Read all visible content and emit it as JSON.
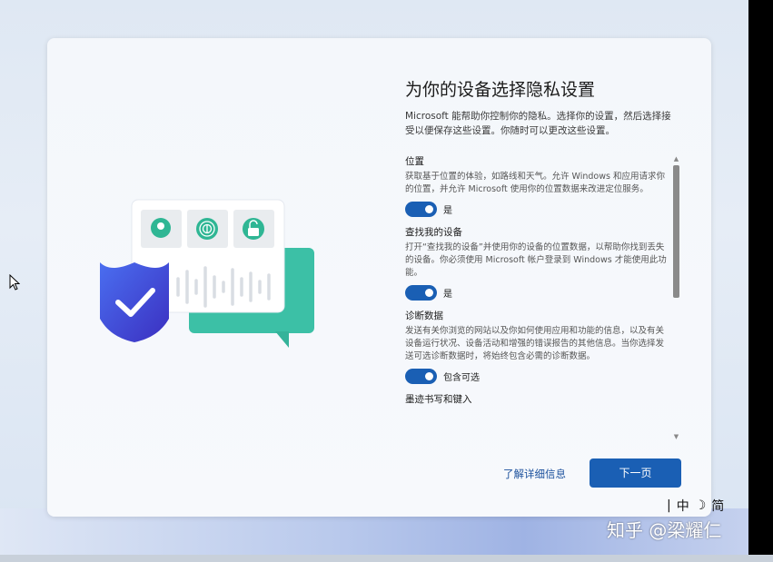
{
  "page": {
    "title": "为你的设备选择隐私设置",
    "description": "Microsoft 能帮助你控制你的隐私。选择你的设置，然后选择接受以便保存这些设置。你随时可以更改这些设置。"
  },
  "settings": [
    {
      "title": "位置",
      "description": "获取基于位置的体验，如路线和天气。允许 Windows 和应用请求你的位置，并允许 Microsoft 使用你的位置数据来改进定位服务。",
      "toggle_label": "是",
      "enabled": true
    },
    {
      "title": "查找我的设备",
      "description": "打开“查找我的设备”并使用你的设备的位置数据，以帮助你找到丢失的设备。你必须使用 Microsoft 帐户登录到 Windows 才能使用此功能。",
      "toggle_label": "是",
      "enabled": true
    },
    {
      "title": "诊断数据",
      "description": "发送有关你浏览的网站以及你如何使用应用和功能的信息，以及有关设备运行状况、设备活动和增强的错误报告的其他信息。当你选择发送可选诊断数据时，将始终包含必需的诊断数据。",
      "toggle_label": "包含可选",
      "enabled": true
    },
    {
      "title": "墨迹书写和键入"
    }
  ],
  "actions": {
    "learn_more": "了解详细信息",
    "next": "下一页"
  },
  "ime": {
    "separator": "|",
    "mode": "中",
    "moon": "☽",
    "script": "简"
  },
  "watermark": "知乎 @梁耀仁",
  "colors": {
    "accent": "#1a5fb4",
    "link": "#1a4f9c",
    "teal": "#3cc0a6",
    "shield": "#3f55d6"
  },
  "icons": [
    "location-icon",
    "fingerprint-icon",
    "unlock-icon",
    "shield-check-icon",
    "mouse-cursor-icon"
  ]
}
